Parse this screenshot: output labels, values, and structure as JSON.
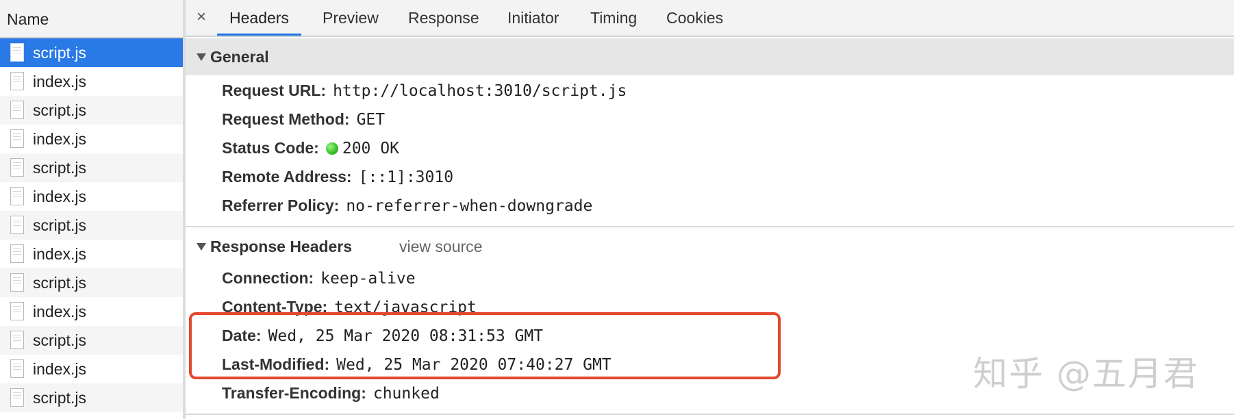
{
  "network_list": {
    "header": "Name",
    "files": [
      {
        "name": "script.js",
        "selected": true
      },
      {
        "name": "index.js"
      },
      {
        "name": "script.js"
      },
      {
        "name": "index.js"
      },
      {
        "name": "script.js"
      },
      {
        "name": "index.js"
      },
      {
        "name": "script.js"
      },
      {
        "name": "index.js"
      },
      {
        "name": "script.js"
      },
      {
        "name": "index.js"
      },
      {
        "name": "script.js"
      },
      {
        "name": "index.js"
      },
      {
        "name": "script.js"
      }
    ]
  },
  "tabs": {
    "close": "×",
    "items": [
      "Headers",
      "Preview",
      "Response",
      "Initiator",
      "Timing",
      "Cookies"
    ],
    "active": "Headers"
  },
  "general": {
    "title": "General",
    "request_url_label": "Request URL:",
    "request_url": "http://localhost:3010/script.js",
    "request_method_label": "Request Method:",
    "request_method": "GET",
    "status_code_label": "Status Code:",
    "status_code": "200 OK",
    "status_color": "#3cc22c",
    "remote_address_label": "Remote Address:",
    "remote_address": "[::1]:3010",
    "referrer_policy_label": "Referrer Policy:",
    "referrer_policy": "no-referrer-when-downgrade"
  },
  "response_headers": {
    "title": "Response Headers",
    "view_source": "view source",
    "connection_label": "Connection:",
    "connection": "keep-alive",
    "content_type_label": "Content-Type:",
    "content_type": "text/javascript",
    "date_label": "Date:",
    "date": "Wed, 25 Mar 2020 08:31:53 GMT",
    "last_modified_label": "Last-Modified:",
    "last_modified": "Wed, 25 Mar 2020 07:40:27 GMT",
    "transfer_encoding_label": "Transfer-Encoding:",
    "transfer_encoding": "chunked"
  },
  "annotation": {
    "highlight_color": "#e4482e"
  },
  "watermark": "知乎 @五月君",
  "colors": {
    "selected_row": "#2979e6",
    "active_tab_underline": "#1a73e8"
  }
}
